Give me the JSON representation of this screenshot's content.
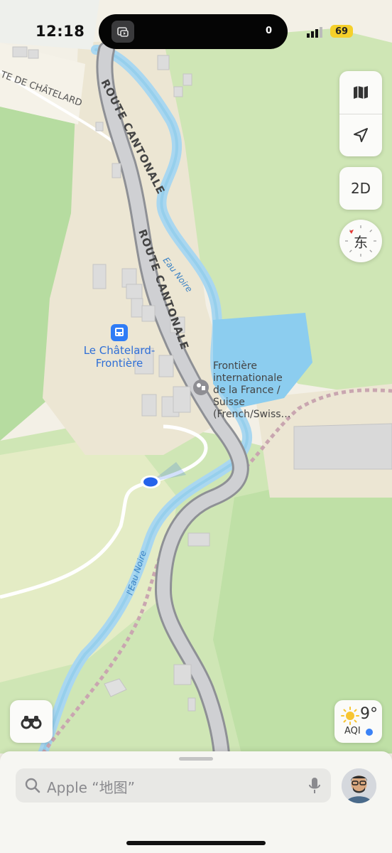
{
  "status_bar": {
    "time": "12:18",
    "island_count": "0",
    "battery": "69"
  },
  "map": {
    "road_labels": [
      "ROUTE CANTONALE",
      "ROUTE CANTONALE",
      "TE DE CHÂTELARD"
    ],
    "river_labels": [
      "Eau Noire",
      "l'Eau Noire"
    ],
    "station": {
      "line1": "Le Châtelard-",
      "line2": "Frontière",
      "icon": "train-icon",
      "color": "#2f7cf6"
    },
    "border_poi": {
      "lines": [
        "Frontière",
        "internationale",
        "de la France /",
        "Suisse",
        "(French/Swiss…"
      ],
      "icon": "border-crossing-icon"
    },
    "location_dot_color": "#2563eb"
  },
  "controls": {
    "map_mode_icon": "map-icon",
    "locate_icon": "location-arrow-icon",
    "view_toggle": "2D",
    "compass_heading": "东",
    "lookaround_icon": "binoculars-icon"
  },
  "weather": {
    "temperature": "9°",
    "aqi_label": "AQI",
    "icon": "sun-icon"
  },
  "search": {
    "placeholder": "Apple “地图”"
  }
}
